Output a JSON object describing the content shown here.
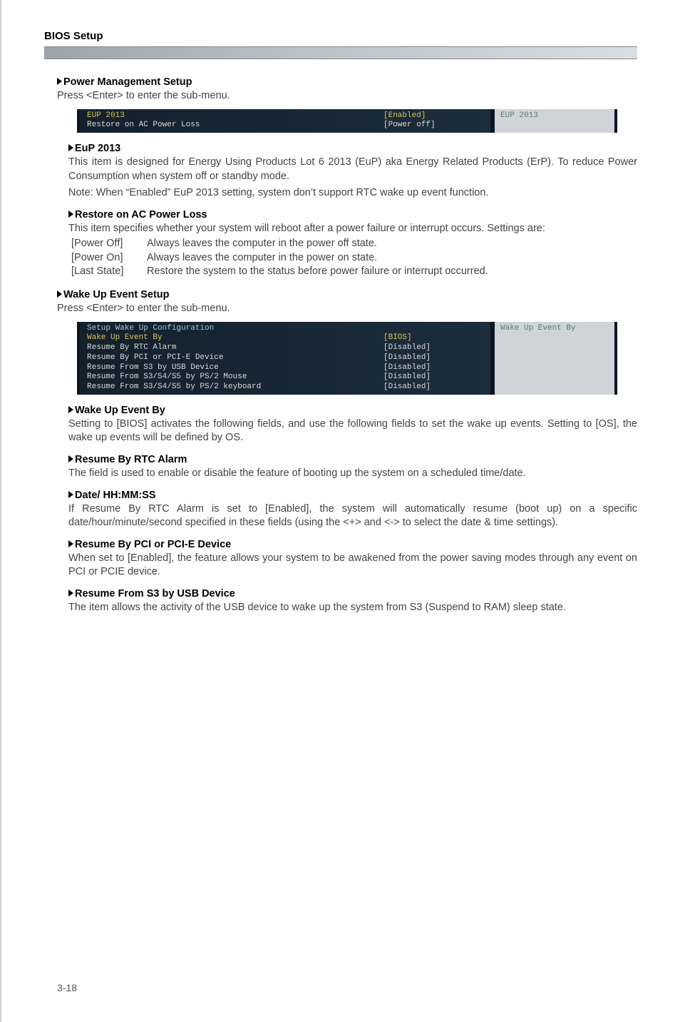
{
  "header": {
    "title": "BIOS Setup"
  },
  "pms": {
    "title": "Power Management Setup",
    "intro": "Press <Enter> to enter the sub-menu.",
    "bios": {
      "rows": [
        {
          "label": "EUP 2013",
          "value": "[Enabled]",
          "cls": "c-yellow"
        },
        {
          "label": "Restore on AC Power Loss",
          "value": "[Power off]",
          "cls": "c-white"
        }
      ],
      "right": "EUP 2013"
    },
    "eup": {
      "title": "EuP 2013",
      "p1": "This item is designed for Energy Using Products Lot 6 2013 (EuP) aka Energy Related Products (ErP). To reduce Power Consumption when system off or standby mode.",
      "p2": "Note: When “Enabled” EuP 2013 setting, system don’t support RTC wake up event function."
    },
    "restore": {
      "title": "Restore on AC Power Loss",
      "p1": "This item specifies whether your system will reboot after a power failure or interrupt occurs. Settings are:",
      "opts": [
        {
          "label": "[Power Off]",
          "desc": "Always leaves the computer in the power off state."
        },
        {
          "label": "[Power On]",
          "desc": "Always leaves the computer in the power on state."
        },
        {
          "label": "[Last State]",
          "desc": "Restore the system to the status before power failure or interrupt occurred."
        }
      ]
    }
  },
  "wake": {
    "title": "Wake Up Event Setup",
    "intro": "Press <Enter> to enter the sub-menu.",
    "bios": {
      "header": "Setup Wake Up Configuration",
      "rows": [
        {
          "label": "Wake Up Event By",
          "value": "[BIOS]",
          "cls": "c-yellow"
        },
        {
          "label": "Resume By RTC Alarm",
          "value": "[Disabled]",
          "cls": "c-white"
        },
        {
          "label": "Resume By PCI or PCI-E Device",
          "value": "[Disabled]",
          "cls": "c-white"
        },
        {
          "label": "Resume From S3 by USB Device",
          "value": "[Disabled]",
          "cls": "c-white"
        },
        {
          "label": "Resume From S3/S4/S5 by PS/2 Mouse",
          "value": "[Disabled]",
          "cls": "c-white"
        },
        {
          "label": "Resume From S3/S4/S5 by PS/2 keyboard",
          "value": "[Disabled]",
          "cls": "c-white"
        }
      ],
      "right": "Wake Up Event By"
    },
    "by": {
      "title": "Wake Up Event By",
      "p1": "Setting to [BIOS] activates the following fields, and use the following fields to set the wake up events. Setting to [OS], the wake up events will be defined by OS."
    },
    "rtc": {
      "title": "Resume By RTC Alarm",
      "p1": "The field is used to enable or disable the feature of booting up the system on a scheduled time/date."
    },
    "date": {
      "title": "Date/ HH:MM:SS",
      "p1": "If Resume By RTC Alarm is set to [Enabled], the system will automatically resume (boot up) on a specific date/hour/minute/second specified in these fields (using the <+> and <-> to select the date & time settings)."
    },
    "pci": {
      "title": "Resume By PCI or PCI-E Device",
      "p1": "When set to [Enabled], the feature allows your system to be awakened from the power saving modes through any event on PCI or PCIE device."
    },
    "usb": {
      "title": "Resume From S3 by USB Device",
      "p1": "The item allows the activity of the USB device to wake up the system from S3 (Suspend to RAM) sleep state."
    }
  },
  "footer": "3-18"
}
